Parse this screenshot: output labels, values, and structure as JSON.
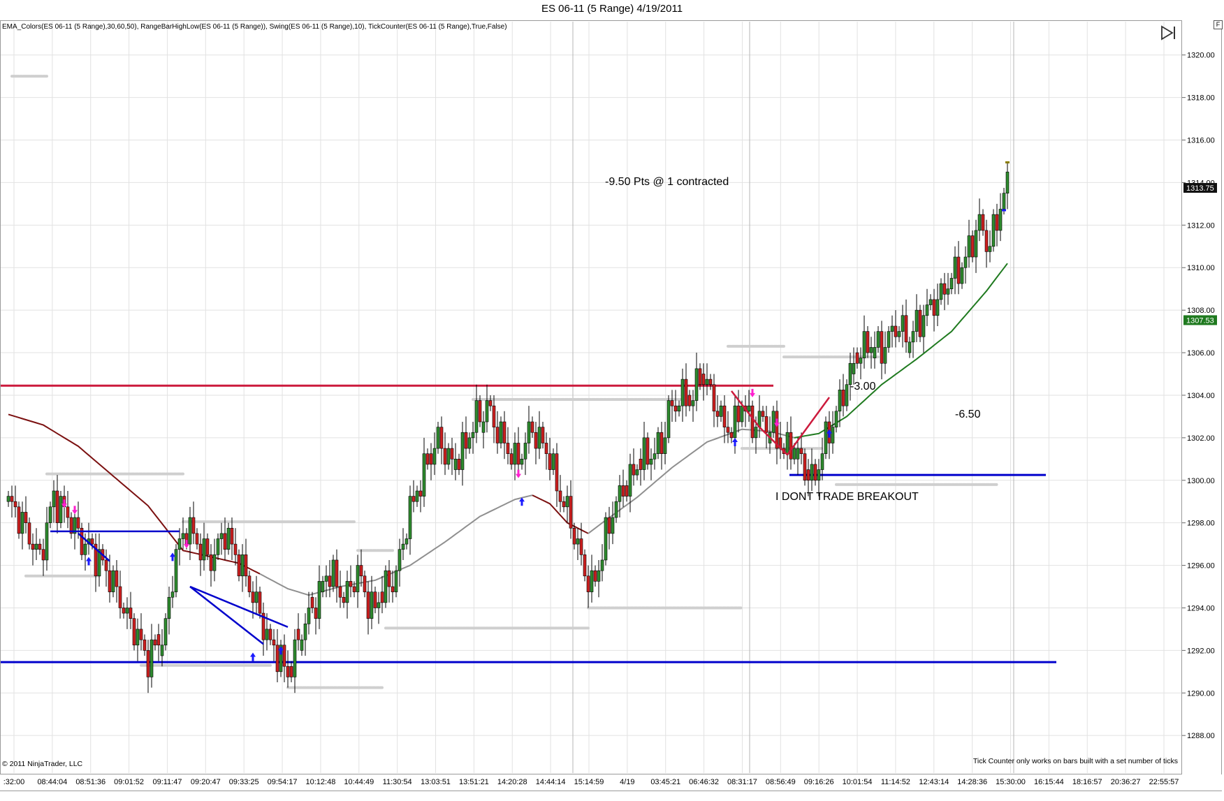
{
  "title": "ES 06-11 (5 Range)  4/19/2011",
  "indicators_label": "EMA_Colors(ES 06-11 (5 Range),30,60,50), RangeBarHighLow(ES 06-11 (5 Range)), Swing(ES 06-11 (5 Range),10), TickCounter(ES 06-11 (5 Range),True,False)",
  "copyright": "© 2011 NinjaTrader, LLC",
  "footnote": "Tick Counter only works on bars built with a set number of ticks",
  "panel_button": "F",
  "annotations": {
    "pts_note": "-9.50 Pts @ 1 contracted",
    "trade1": "-3.00",
    "trade2": "-6.50",
    "breakout": "I DONT TRADE BREAKOUT"
  },
  "price_badges": {
    "last": "1313.75",
    "ema": "1307.53"
  },
  "colors": {
    "up_candle": "#2e8b2e",
    "down_candle": "#cc1f1f",
    "ema_down": "#7b1010",
    "ema_flat": "#8f8f8f",
    "ema_up": "#1f7a1f",
    "support_line": "#0000cc",
    "resistance_line": "#cc1a3c",
    "swing_dots": "#cfcfcf",
    "grid": "#e2e2e2",
    "badge_last": "#111111",
    "badge_ema": "#1f7a1f"
  },
  "chart_data": {
    "type": "candlestick",
    "title": "ES 06-11 (5 Range)  4/19/2011",
    "y_ticks": [
      "1288.00",
      "1290.00",
      "1292.00",
      "1294.00",
      "1296.00",
      "1298.00",
      "1300.00",
      "1302.00",
      "1304.00",
      "1306.00",
      "1308.00",
      "1310.00",
      "1312.00",
      "1314.00",
      "1316.00",
      "1318.00",
      "1320.00"
    ],
    "ylim": [
      1286.2,
      1321.6
    ],
    "x_tick_labels": [
      ":32:00",
      "08:44:04",
      "08:51:36",
      "09:01:52",
      "09:11:47",
      "09:20:47",
      "09:33:25",
      "09:54:17",
      "10:12:48",
      "10:44:49",
      "11:30:54",
      "13:03:51",
      "13:51:21",
      "14:20:28",
      "14:44:14",
      "15:14:59",
      "4/19",
      "03:45:21",
      "06:46:32",
      "08:31:17",
      "08:56:49",
      "09:16:26",
      "10:01:54",
      "11:14:52",
      "12:43:14",
      "14:28:36",
      "15:30:00",
      "16:15:44",
      "18:16:57",
      "20:36:27",
      "22:55:57"
    ],
    "price_path": [
      [
        0,
        1299
      ],
      [
        5,
        1297.8
      ],
      [
        9,
        1296.3
      ],
      [
        13,
        1299.2
      ],
      [
        17,
        1298.3
      ],
      [
        20,
        1297.4
      ],
      [
        25,
        1296.5
      ],
      [
        30,
        1295.2
      ],
      [
        35,
        1293.3
      ],
      [
        40,
        1291.6
      ],
      [
        45,
        1293.0
      ],
      [
        48,
        1296.5
      ],
      [
        51,
        1297.8
      ],
      [
        55,
        1296.8
      ],
      [
        58,
        1296.2
      ],
      [
        62,
        1297.6
      ],
      [
        66,
        1296.2
      ],
      [
        70,
        1294.5
      ],
      [
        75,
        1292.3
      ],
      [
        77,
        1291.9
      ],
      [
        80,
        1290.9
      ],
      [
        84,
        1292.9
      ],
      [
        88,
        1294.3
      ],
      [
        92,
        1295.8
      ],
      [
        96,
        1294.4
      ],
      [
        100,
        1295.7
      ],
      [
        104,
        1293.9
      ],
      [
        108,
        1294.9
      ],
      [
        111,
        1295.6
      ],
      [
        115,
        1298.6
      ],
      [
        119,
        1300.4
      ],
      [
        123,
        1302.0
      ],
      [
        127,
        1300.8
      ],
      [
        130,
        1301.4
      ],
      [
        134,
        1302.9
      ],
      [
        137,
        1303.4
      ],
      [
        140,
        1302.3
      ],
      [
        145,
        1300.8
      ],
      [
        150,
        1302.4
      ],
      [
        154,
        1301.5
      ],
      [
        157,
        1299.8
      ],
      [
        161,
        1298.0
      ],
      [
        164,
        1296.2
      ],
      [
        167,
        1295.0
      ],
      [
        170,
        1296.6
      ],
      [
        173,
        1298.6
      ],
      [
        177,
        1299.8
      ],
      [
        181,
        1300.9
      ],
      [
        184,
        1301.3
      ],
      [
        187,
        1301.6
      ],
      [
        189,
        1303.2
      ],
      [
        192,
        1303.9
      ],
      [
        195,
        1303.6
      ],
      [
        198,
        1305.0
      ],
      [
        201,
        1304.2
      ],
      [
        204,
        1302.8
      ],
      [
        207,
        1302.2
      ],
      [
        210,
        1303.6
      ],
      [
        213,
        1302.6
      ],
      [
        216,
        1302.8
      ],
      [
        219,
        1302.3
      ],
      [
        222,
        1301.3
      ],
      [
        225,
        1301.7
      ],
      [
        227,
        1300.9
      ],
      [
        230,
        1299.9
      ],
      [
        234,
        1301.8
      ],
      [
        238,
        1303.6
      ],
      [
        242,
        1305.5
      ],
      [
        246,
        1306.5
      ],
      [
        250,
        1306.1
      ],
      [
        254,
        1307.2
      ],
      [
        258,
        1306.8
      ],
      [
        262,
        1307.8
      ],
      [
        266,
        1308.5
      ],
      [
        270,
        1309.5
      ],
      [
        274,
        1310.4
      ],
      [
        278,
        1312.1
      ],
      [
        281,
        1311.0
      ],
      [
        284,
        1313.0
      ],
      [
        286,
        1313.75
      ]
    ],
    "ema": [
      [
        0,
        1303.1
      ],
      [
        10,
        1302.6
      ],
      [
        20,
        1301.6
      ],
      [
        30,
        1300.2
      ],
      [
        40,
        1298.8
      ],
      [
        50,
        1296.7
      ],
      [
        58,
        1296.4
      ],
      [
        66,
        1296.1
      ],
      [
        72,
        1295.6
      ],
      [
        80,
        1294.9
      ],
      [
        86,
        1294.6
      ],
      [
        95,
        1295.0
      ],
      [
        105,
        1295.3
      ],
      [
        115,
        1296.0
      ],
      [
        125,
        1297.1
      ],
      [
        135,
        1298.3
      ],
      [
        145,
        1299.1
      ],
      [
        150,
        1299.3
      ],
      [
        155,
        1298.9
      ],
      [
        160,
        1298.0
      ],
      [
        166,
        1297.5
      ],
      [
        170,
        1298.0
      ],
      [
        180,
        1299.2
      ],
      [
        190,
        1300.6
      ],
      [
        200,
        1301.8
      ],
      [
        210,
        1302.4
      ],
      [
        218,
        1302.3
      ],
      [
        225,
        1302.0
      ],
      [
        232,
        1302.2
      ],
      [
        240,
        1303.0
      ],
      [
        250,
        1304.5
      ],
      [
        260,
        1305.7
      ],
      [
        270,
        1307.0
      ],
      [
        280,
        1308.9
      ],
      [
        286,
        1310.2
      ]
    ],
    "ema_segments": [
      [
        0,
        72,
        "down"
      ],
      [
        72,
        150,
        "flat"
      ],
      [
        150,
        166,
        "down"
      ],
      [
        166,
        225,
        "flat"
      ],
      [
        225,
        286,
        "up"
      ]
    ],
    "horizontal_lines": [
      {
        "price": 1304.45,
        "x_from": 0,
        "x_to": 219,
        "color": "red"
      },
      {
        "price": 1291.45,
        "x_from": 0,
        "x_to": 300,
        "color": "blue"
      },
      {
        "price": 1300.25,
        "x_from": 226,
        "x_to": 297,
        "color": "blue"
      }
    ],
    "swing_levels": [
      {
        "price": 1300.3,
        "x_from": 11,
        "x_to": 50
      },
      {
        "price": 1298.05,
        "x_from": 50,
        "x_to": 99
      },
      {
        "price": 1295.5,
        "x_from": 5,
        "x_to": 26
      },
      {
        "price": 1291.3,
        "x_from": 38,
        "x_to": 75
      },
      {
        "price": 1290.25,
        "x_from": 80,
        "x_to": 107
      },
      {
        "price": 1293.05,
        "x_from": 108,
        "x_to": 166
      },
      {
        "price": 1296.7,
        "x_from": 100,
        "x_to": 110
      },
      {
        "price": 1303.8,
        "x_from": 133,
        "x_to": 193
      },
      {
        "price": 1294.0,
        "x_from": 166,
        "x_to": 210
      },
      {
        "price": 1306.3,
        "x_from": 206,
        "x_to": 222
      },
      {
        "price": 1305.8,
        "x_from": 222,
        "x_to": 249
      },
      {
        "price": 1301.5,
        "x_from": 210,
        "x_to": 233
      },
      {
        "price": 1299.8,
        "x_from": 237,
        "x_to": 283
      },
      {
        "price": 1319.0,
        "x_from": 1,
        "x_to": 11
      }
    ]
  }
}
